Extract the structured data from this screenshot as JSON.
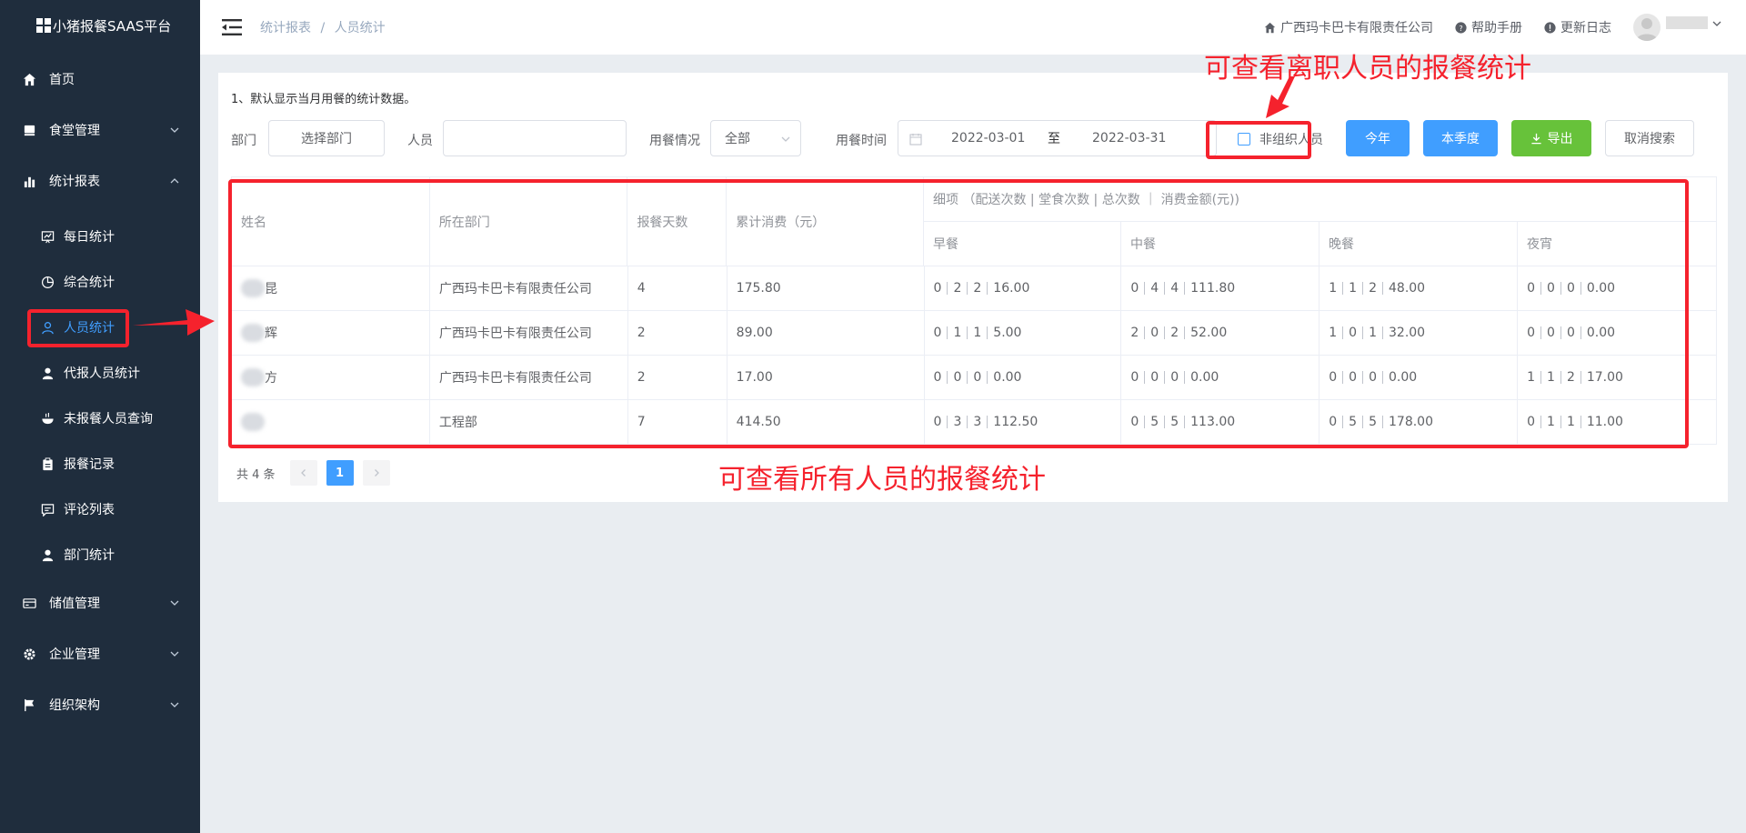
{
  "app": {
    "title": "小猪报餐SAAS平台"
  },
  "sidebar": {
    "items": [
      {
        "label": "首页",
        "icon": "home-icon"
      },
      {
        "label": "食堂管理",
        "icon": "canteen-icon"
      },
      {
        "label": "统计报表",
        "icon": "chart-icon"
      }
    ],
    "subitems": [
      {
        "label": "每日统计",
        "icon": "daily-chart-icon"
      },
      {
        "label": "综合统计",
        "icon": "pie-icon"
      },
      {
        "label": "人员统计",
        "icon": "user-icon",
        "active": true
      },
      {
        "label": "代报人员统计",
        "icon": "user-icon"
      },
      {
        "label": "未报餐人员查询",
        "icon": "bowl-icon"
      },
      {
        "label": "报餐记录",
        "icon": "clipboard-icon"
      },
      {
        "label": "评论列表",
        "icon": "comment-icon"
      },
      {
        "label": "部门统计",
        "icon": "user-icon"
      }
    ],
    "bottom_items": [
      {
        "label": "储值管理",
        "icon": "card-icon"
      },
      {
        "label": "企业管理",
        "icon": "gear-icon"
      },
      {
        "label": "组织架构",
        "icon": "flag-icon"
      }
    ]
  },
  "header": {
    "breadcrumb_parent": "统计报表",
    "breadcrumb_sep": "/",
    "breadcrumb_current": "人员统计",
    "company": "广西玛卡巴卡有限责任公司",
    "help": "帮助手册",
    "changelog": "更新日志"
  },
  "main": {
    "tip": "1、默认显示当月用餐的统计数据。",
    "filters": {
      "dept_label": "部门",
      "dept_button": "选择部门",
      "person_label": "人员",
      "person_value": "",
      "meal_label": "用餐情况",
      "meal_value": "全部",
      "time_label": "用餐时间",
      "date_start": "2022-03-01",
      "date_to": "至",
      "date_end": "2022-03-31",
      "non_org_label": "非组织人员",
      "btn_year": "今年",
      "btn_quarter": "本季度",
      "btn_export": "导出",
      "btn_cancel": "取消搜索"
    },
    "table": {
      "headers": {
        "name": "姓名",
        "dept": "所在部门",
        "days": "报餐天数",
        "total": "累计消费（元）",
        "detail": "细项 （配送次数 | 堂食次数 | 总次数 ｜ 消费金额(元))",
        "breakfast": "早餐",
        "lunch": "中餐",
        "dinner": "晚餐",
        "night": "夜宵"
      },
      "rows": [
        {
          "name": "昆",
          "dept": "广西玛卡巴卡有限责任公司",
          "days": "4",
          "total": "175.80",
          "breakfast": [
            "0",
            "2",
            "2",
            "16.00"
          ],
          "lunch": [
            "0",
            "4",
            "4",
            "111.80"
          ],
          "dinner": [
            "1",
            "1",
            "2",
            "48.00"
          ],
          "night": [
            "0",
            "0",
            "0",
            "0.00"
          ]
        },
        {
          "name": "辉",
          "dept": "广西玛卡巴卡有限责任公司",
          "days": "2",
          "total": "89.00",
          "breakfast": [
            "0",
            "1",
            "1",
            "5.00"
          ],
          "lunch": [
            "2",
            "0",
            "2",
            "52.00"
          ],
          "dinner": [
            "1",
            "0",
            "1",
            "32.00"
          ],
          "night": [
            "0",
            "0",
            "0",
            "0.00"
          ]
        },
        {
          "name": "方",
          "dept": "广西玛卡巴卡有限责任公司",
          "days": "2",
          "total": "17.00",
          "breakfast": [
            "0",
            "0",
            "0",
            "0.00"
          ],
          "lunch": [
            "0",
            "0",
            "0",
            "0.00"
          ],
          "dinner": [
            "0",
            "0",
            "0",
            "0.00"
          ],
          "night": [
            "1",
            "1",
            "2",
            "17.00"
          ]
        },
        {
          "name": "",
          "dept": "工程部",
          "days": "7",
          "total": "414.50",
          "breakfast": [
            "0",
            "3",
            "3",
            "112.50"
          ],
          "lunch": [
            "0",
            "5",
            "5",
            "113.00"
          ],
          "dinner": [
            "0",
            "5",
            "5",
            "178.00"
          ],
          "night": [
            "0",
            "1",
            "1",
            "11.00"
          ]
        }
      ]
    },
    "pager": {
      "total": "共 4 条",
      "current": "1"
    }
  },
  "annotations": {
    "top_text": "可查看离职人员的报餐统计",
    "bottom_text": "可查看所有人员的报餐统计"
  },
  "colors": {
    "sidebar_bg": "#1f2d3d",
    "primary": "#409eff",
    "success": "#67c23a",
    "annotation": "#f5222d"
  }
}
